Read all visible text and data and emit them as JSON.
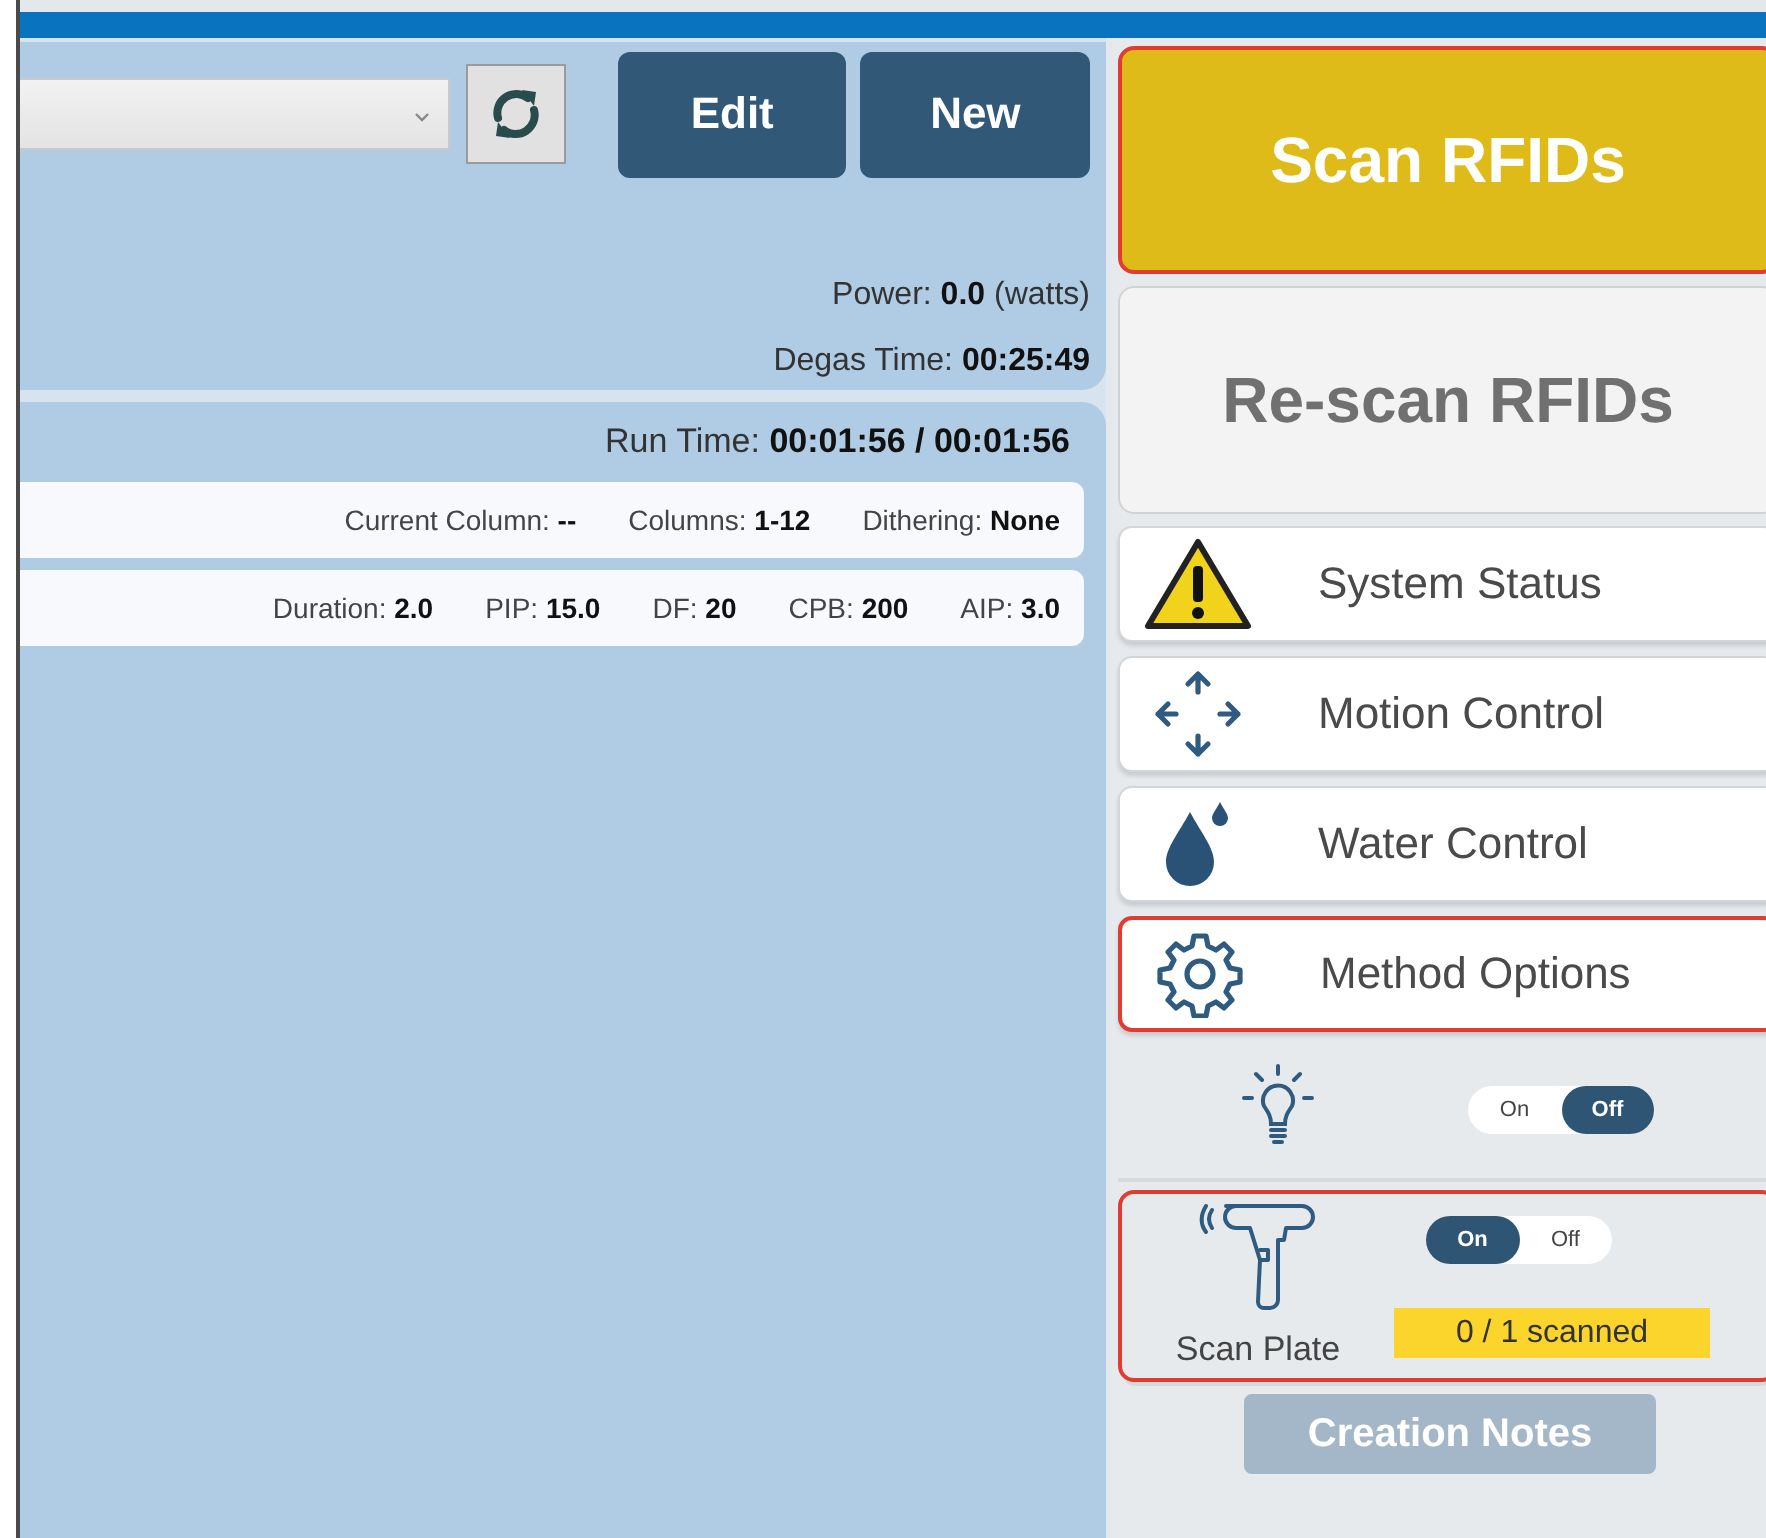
{
  "toolbar": {
    "buttons": [
      {
        "label": "Edit"
      },
      {
        "label": "New"
      }
    ]
  },
  "status_lines": [
    "Power: **0.0** (watts)",
    "Degas Time: **00:25:49**"
  ],
  "run_time": "Run Time: **00:01:56 / 00:01:56**",
  "info_rows": [
    [
      "Current Column: **--**",
      "Columns: **1-12**",
      "Dithering: **None**"
    ],
    [
      "Duration: **2.0**",
      "PIP: **15.0**",
      "DF: **20**",
      "CPB: **200**",
      "AIP: **3.0**"
    ]
  ],
  "scan_buttons": [
    {
      "label": "Scan RFIDs",
      "kind": "primary",
      "highlighted": true,
      "disabled": false
    },
    {
      "label": "Re-scan RFIDs",
      "kind": "secondary",
      "highlighted": false,
      "disabled": true
    }
  ],
  "nav_items": [
    {
      "label": "System Status",
      "kind": "warning",
      "highlighted": false
    },
    {
      "label": "Motion Control",
      "kind": "arrows",
      "highlighted": false
    },
    {
      "label": "Water Control",
      "kind": "drop",
      "highlighted": false
    },
    {
      "label": "Method Options",
      "kind": "gear",
      "highlighted": true
    }
  ],
  "toggles": [
    {
      "kind": "light",
      "highlighted": false,
      "options": [
        {
          "label": "On",
          "selected": false
        },
        {
          "label": "Off",
          "selected": true
        }
      ]
    },
    {
      "kind": "scanner",
      "highlighted": true,
      "label": "Scan Plate",
      "status": "0 / 1 scanned",
      "options": [
        {
          "label": "On",
          "selected": true
        },
        {
          "label": "Off",
          "selected": false
        }
      ]
    }
  ],
  "creation_notes": {
    "label": "Creation Notes",
    "disabled": true
  }
}
